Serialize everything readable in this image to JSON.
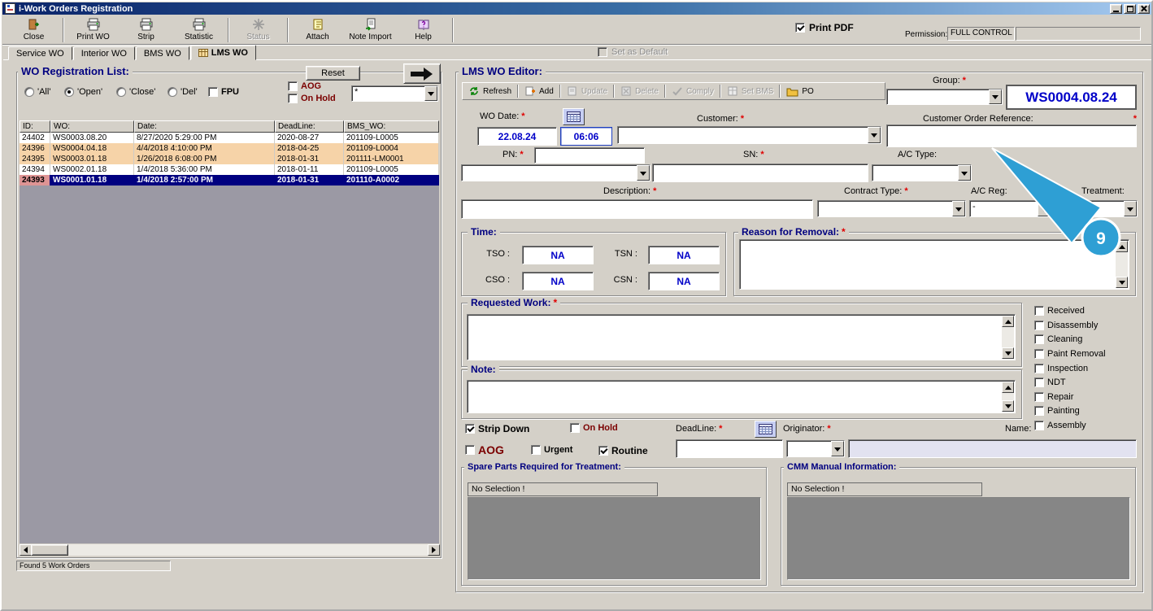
{
  "required_marker": "*",
  "window": {
    "title": "i-Work Orders Registration"
  },
  "toolbar": {
    "buttons": [
      {
        "label": "Close",
        "icon": "exit-door-icon",
        "disabled": false
      },
      {
        "label": "Print WO",
        "icon": "printer-icon",
        "disabled": false
      },
      {
        "label": "Strip",
        "icon": "printer-icon",
        "disabled": false
      },
      {
        "label": "Statistic",
        "icon": "printer-icon",
        "disabled": false
      },
      {
        "label": "Status",
        "icon": "snowflake-icon",
        "disabled": true
      },
      {
        "label": "Attach",
        "icon": "attach-icon",
        "disabled": false
      },
      {
        "label": "Note Import",
        "icon": "note-icon",
        "disabled": false
      },
      {
        "label": "Help",
        "icon": "help-icon",
        "disabled": false
      }
    ],
    "print_pdf": {
      "label": "Print PDF",
      "checked": true
    },
    "permission": {
      "label": "Permission:",
      "value": "FULL CONTROL"
    }
  },
  "tabs": {
    "items": [
      {
        "label": "Service WO",
        "active": false
      },
      {
        "label": "Interior WO",
        "active": false
      },
      {
        "label": "BMS WO",
        "active": false
      },
      {
        "label": "LMS WO",
        "active": true
      }
    ],
    "set_as_default": {
      "label": "Set as Default",
      "checked": false,
      "disabled": true
    }
  },
  "wo_list": {
    "title": "WO Registration List:",
    "reset_label": "Reset",
    "filters": {
      "all": {
        "label": "'All'",
        "checked": false
      },
      "open": {
        "label": "'Open'",
        "checked": true
      },
      "close": {
        "label": "'Close'",
        "checked": false
      },
      "del": {
        "label": "'Del'",
        "checked": false
      },
      "fpu": {
        "label": "FPU",
        "checked": false
      },
      "aog": {
        "label": "AOG",
        "checked": false
      },
      "on_hold": {
        "label": "On Hold",
        "checked": false
      },
      "search_value": "*"
    },
    "columns": {
      "id": "ID:",
      "wo": "WO:",
      "date": "Date:",
      "deadline": "DeadLine:",
      "bms": "BMS_WO:"
    },
    "rows": [
      {
        "id": "24402",
        "wo": "WS0003.08.20",
        "date": "8/27/2020 5:29:00 PM",
        "deadline": "2020-08-27",
        "bms": "201109-L0005",
        "highlight": ""
      },
      {
        "id": "24396",
        "wo": "WS0004.04.18",
        "date": "4/4/2018 4:10:00 PM",
        "deadline": "2018-04-25",
        "bms": "201109-L0004",
        "highlight": "overdue"
      },
      {
        "id": "24395",
        "wo": "WS0003.01.18",
        "date": "1/26/2018 6:08:00 PM",
        "deadline": "2018-01-31",
        "bms": "201111-LM0001",
        "highlight": "overdue"
      },
      {
        "id": "24394",
        "wo": "WS0002.01.18",
        "date": "1/4/2018 5:36:00 PM",
        "deadline": "2018-01-11",
        "bms": "201109-L0005",
        "highlight": ""
      },
      {
        "id": "24393",
        "wo": "WS0001.01.18",
        "date": "1/4/2018 2:57:00 PM",
        "deadline": "2018-01-31",
        "bms": "201110-A0002",
        "highlight": "selected"
      }
    ],
    "footer": "Found 5 Work Orders"
  },
  "editor": {
    "title": "LMS WO Editor:",
    "toolbar": [
      {
        "label": "Refresh",
        "disabled": false
      },
      {
        "label": "Add",
        "disabled": false
      },
      {
        "label": "Update",
        "disabled": true
      },
      {
        "label": "Delete",
        "disabled": true
      },
      {
        "label": "Comply",
        "disabled": true
      },
      {
        "label": "Set BMS",
        "disabled": true
      },
      {
        "label": "PO",
        "disabled": false
      }
    ],
    "group_label": "Group:",
    "wo_number": "WS0004.08.24",
    "wo_date": {
      "label": "WO Date:",
      "date": "22.08.24",
      "time": "06:06"
    },
    "customer_label": "Customer:",
    "customer_order_ref_label": "Customer Order Reference:",
    "pn_label": "PN:",
    "sn_label": "SN:",
    "ac_type_label": "A/C Type:",
    "description_label": "Description:",
    "contract_type_label": "Contract Type:",
    "ac_reg_label": "A/C Reg:",
    "ac_reg_value": "-",
    "treatment_label": "Treatment:",
    "time_box": {
      "title": "Time:",
      "tso_label": "TSO :",
      "tsn_label": "TSN :",
      "cso_label": "CSO :",
      "csn_label": "CSN :",
      "tso": "NA",
      "tsn": "NA",
      "cso": "NA",
      "csn": "NA"
    },
    "reason_title": "Reason for Removal:",
    "requested_title": "Requested Work:",
    "note_title": "Note:",
    "steps": [
      {
        "label": "Received",
        "checked": false
      },
      {
        "label": "Disassembly",
        "checked": false
      },
      {
        "label": "Cleaning",
        "checked": false
      },
      {
        "label": "Paint Removal",
        "checked": false
      },
      {
        "label": "Inspection",
        "checked": false
      },
      {
        "label": "NDT",
        "checked": false
      },
      {
        "label": "Repair",
        "checked": false
      },
      {
        "label": "Painting",
        "checked": false
      },
      {
        "label": "Assembly",
        "checked": false
      }
    ],
    "flags": {
      "strip_down": {
        "label": "Strip Down",
        "checked": true
      },
      "on_hold": {
        "label": "On Hold",
        "checked": false
      },
      "aog": {
        "label": "AOG",
        "checked": false
      },
      "urgent": {
        "label": "Urgent",
        "checked": false
      },
      "routine": {
        "label": "Routine",
        "checked": true
      }
    },
    "deadline_label": "DeadLine:",
    "originator_label": "Originator:",
    "name_label": "Name:",
    "spare_parts": {
      "title": "Spare Parts Required for Treatment:",
      "value": "No Selection !"
    },
    "cmm": {
      "title": "CMM Manual Information:",
      "value": "No Selection !"
    }
  },
  "callout": {
    "label": "9"
  },
  "colors": {
    "title_navy": "#000080",
    "alert_dark_red": "#7b0000",
    "value_blue": "#0000c8",
    "selected_row_bg": "#000080",
    "overdue_row_bg": "#f6d3a8",
    "callout_blue": "#2e9fd4"
  }
}
